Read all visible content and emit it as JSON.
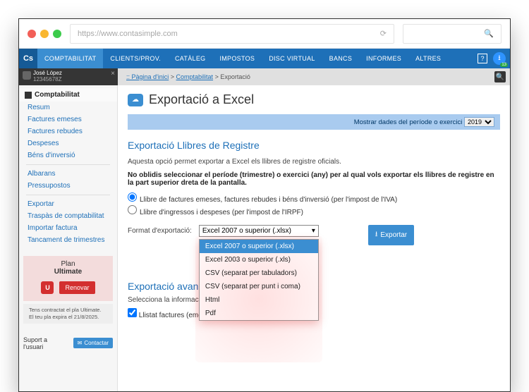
{
  "browser": {
    "url": "https://www.contasimple.com"
  },
  "nav": {
    "logo": "Cs",
    "items": [
      "COMPTABILITAT",
      "CLIENTS/PROV.",
      "CATÀLEG",
      "IMPOSTOS",
      "DISC VIRTUAL",
      "BANCS",
      "INFORMES",
      "ALTRES"
    ]
  },
  "user": {
    "name": "José López",
    "id": "12345678Z"
  },
  "breadcrumb": {
    "home": ":: Pàgina d'inici",
    "mid": "Comptabilitat",
    "last": "Exportació"
  },
  "sidebar": {
    "header": "Comptabilitat",
    "group1": [
      "Resum",
      "Factures emeses",
      "Factures rebudes",
      "Despeses",
      "Béns d'inversió"
    ],
    "group2": [
      "Albarans",
      "Pressupostos"
    ],
    "group3": [
      "Exportar",
      "Traspàs de comptabilitat",
      "Importar factura",
      "Tancament de trimestres"
    ],
    "plan": {
      "title_a": "Plan",
      "title_b": "Ultimate",
      "renovar": "Renovar",
      "note": "Tens contractat el pla Ultimate. El teu pla expira el 21/8/2025."
    },
    "support": {
      "label": "Suport a l'usuari",
      "btn": "Contactar"
    }
  },
  "page": {
    "title": "Exportació a Excel",
    "period_label": "Mostrar dades del període o exercici",
    "period_value": "2019",
    "sec1_title": "Exportació Llibres de Registre",
    "sec1_desc": "Aquesta opció permet exportar a Excel els llibres de registre oficials.",
    "sec1_bold": "No oblidis seleccionar el període (trimestre) o exercici (any) per al qual vols exportar els llibres de registre en la part superior dreta de la pantalla.",
    "radio1": "Llibre de factures emeses, factures rebudes i béns d'inversió (per l'impost de l'IVA)",
    "radio2": "Llibre d'ingressos i despeses (per l'impost de l'IRPF)",
    "fmt_label": "Format d'exportació:",
    "fmt_selected": "Excel 2007 o superior (.xlsx)",
    "fmt_options": [
      "Excel 2007 o superior (.xlsx)",
      "Excel 2003 o superior (.xls)",
      "CSV (separat per tabuladors)",
      "CSV (separat per punt i coma)",
      "Html",
      "Pdf"
    ],
    "export_btn": "Exportar",
    "sec2_title": "Exportació avançada",
    "sec2_desc": "Selecciona la informació a exportar:",
    "chk1": "Llistat factures (emeses, rebudes i béns de inversió)."
  }
}
